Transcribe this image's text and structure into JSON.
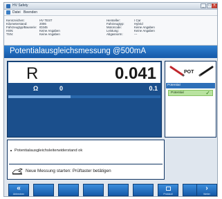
{
  "window": {
    "title": "HV Safety"
  },
  "menu": {
    "items": [
      "Datei",
      "Beenden"
    ]
  },
  "info": {
    "left": [
      {
        "label": "Kennzeichen:",
        "value": "HV TEST"
      },
      {
        "label": "Kilometerstand:",
        "value": "2006"
      },
      {
        "label": "Fahrzeugtyp/Bauserie:",
        "value": "ID345"
      },
      {
        "label": "HSN:",
        "value": "Keine Angaben"
      },
      {
        "label": "TSN:",
        "value": "Keine Angaben"
      }
    ],
    "right": [
      {
        "label": "Hersteller:",
        "value": "I Car"
      },
      {
        "label": "Fahrzeugtyp:",
        "value": "Hybrid"
      },
      {
        "label": "Motorcode:",
        "value": "Keine Angaben"
      },
      {
        "label": "Leistung:",
        "value": "Keine Angaben"
      },
      {
        "label": "Abgasnorm:",
        "value": "---"
      }
    ]
  },
  "header": {
    "title": "Potentialausgleichsmessung @500mA"
  },
  "measurement": {
    "symbol": "R",
    "value": "0.041",
    "unit": "Ω",
    "range_min": "0",
    "range_max": "0.1",
    "bar_fraction": 0.41
  },
  "side": {
    "pot_label": "POT",
    "section": "Potential",
    "item": "Potential",
    "item_status": "✓"
  },
  "message": {
    "result": "Potentialausgleichsleiterwiderstand ok",
    "instruction": "Neue Messung starten: Prüftaster betätigen"
  },
  "bottom": {
    "left_label": "Abbrechen",
    "left_glyph": "«",
    "print_label": "Protokoll",
    "right_label": "Weiter",
    "right_glyph": "›"
  },
  "colors": {
    "accent": "#1458a8",
    "ok_green": "#b9e3a0"
  }
}
